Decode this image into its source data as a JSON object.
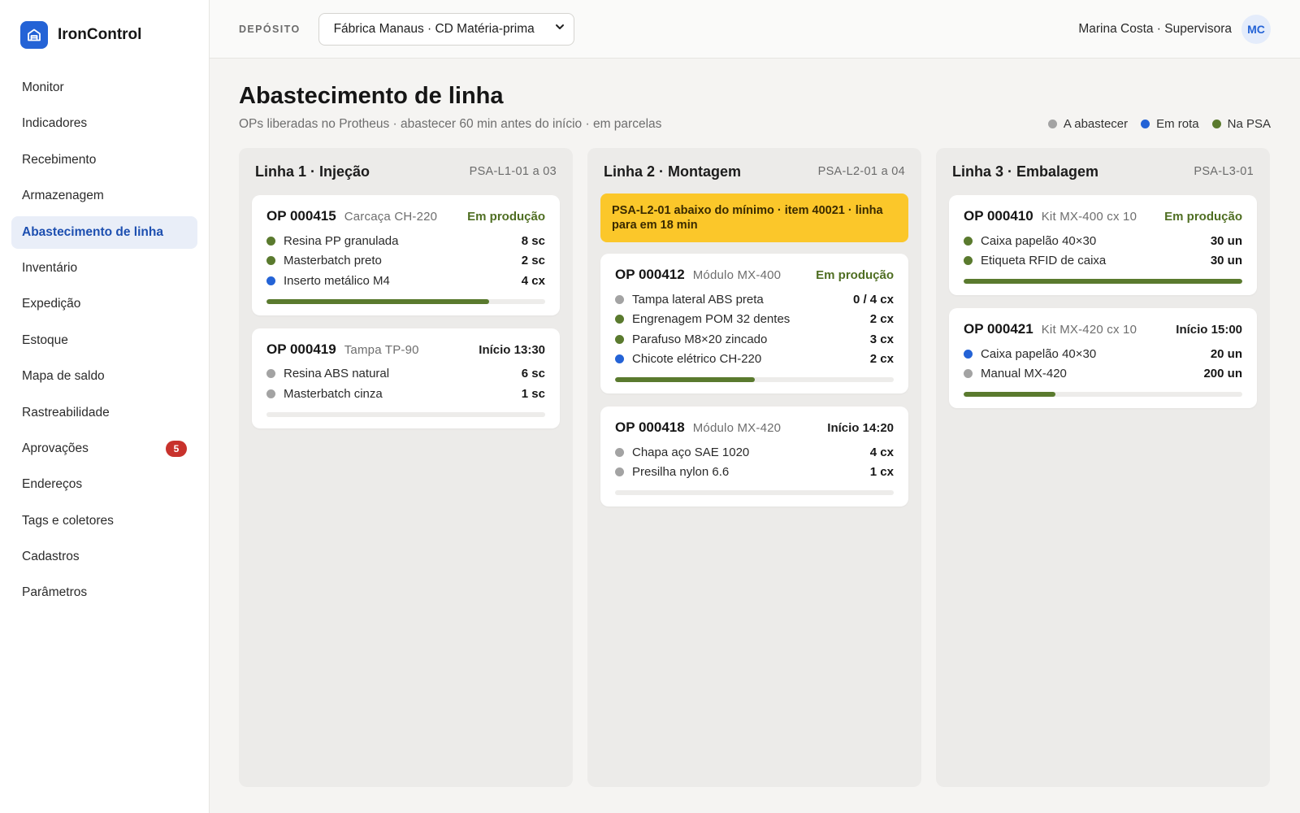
{
  "app": {
    "name": "IronControl"
  },
  "sidebar": {
    "items": [
      {
        "label": "Monitor",
        "name": "sidebar-item-monitor"
      },
      {
        "label": "Indicadores",
        "name": "sidebar-item-indicadores"
      },
      {
        "label": "Recebimento",
        "name": "sidebar-item-recebimento"
      },
      {
        "label": "Armazenagem",
        "name": "sidebar-item-armazenagem"
      },
      {
        "label": "Abastecimento de linha",
        "name": "sidebar-item-abastecimento",
        "active": true
      },
      {
        "label": "Inventário",
        "name": "sidebar-item-inventario"
      },
      {
        "label": "Expedição",
        "name": "sidebar-item-expedicao"
      },
      {
        "label": "Estoque",
        "name": "sidebar-item-estoque"
      },
      {
        "label": "Mapa de saldo",
        "name": "sidebar-item-mapa-de-saldo"
      },
      {
        "label": "Rastreabilidade",
        "name": "sidebar-item-rastreabilidade"
      },
      {
        "label": "Aprovações",
        "name": "sidebar-item-aprovacoes",
        "badge": "5"
      },
      {
        "label": "Endereços",
        "name": "sidebar-item-enderecos"
      },
      {
        "label": "Tags e coletores",
        "name": "sidebar-item-tags-coletores"
      },
      {
        "label": "Cadastros",
        "name": "sidebar-item-cadastros"
      },
      {
        "label": "Parâmetros",
        "name": "sidebar-item-parametros"
      }
    ]
  },
  "header": {
    "deposit_label": "DEPÓSITO",
    "deposit_value": "Fábrica Manaus · CD Matéria-prima",
    "user_name": "Marina Costa · Supervisora",
    "user_initials": "MC"
  },
  "page": {
    "title": "Abastecimento de linha",
    "subtitle": "OPs liberadas no Protheus · abastecer 60 min antes do início · em parcelas"
  },
  "legend": [
    {
      "label": "A abastecer",
      "color": "gray"
    },
    {
      "label": "Em rota",
      "color": "blue"
    },
    {
      "label": "Na PSA",
      "color": "green"
    }
  ],
  "colors": {
    "gray": "#a3a3a3",
    "blue": "#2463d6",
    "green": "#5a7a2e",
    "alert": "#fbc72a",
    "accent": "#2463d6"
  },
  "columns": [
    {
      "title": "Linha 1 · Injeção",
      "psa": "PSA-L1-01 a 03",
      "alert": null,
      "cards": [
        {
          "op": "OP 000415",
          "model": "Carcaça CH-220",
          "status": "Em produção",
          "status_type": "prod",
          "progress": 0.8,
          "items": [
            {
              "label": "Resina PP granulada",
              "qty": "8 sc",
              "state": "green"
            },
            {
              "label": "Masterbatch preto",
              "qty": "2 sc",
              "state": "green"
            },
            {
              "label": "Inserto metálico M4",
              "qty": "4 cx",
              "state": "blue"
            }
          ]
        },
        {
          "op": "OP 000419",
          "model": "Tampa TP-90",
          "status": "Início 13:30",
          "status_type": "start",
          "progress": 0,
          "items": [
            {
              "label": "Resina ABS natural",
              "qty": "6 sc",
              "state": "gray"
            },
            {
              "label": "Masterbatch cinza",
              "qty": "1 sc",
              "state": "gray"
            }
          ]
        }
      ]
    },
    {
      "title": "Linha 2 · Montagem",
      "psa": "PSA-L2-01 a 04",
      "alert": "PSA-L2-01 abaixo do mínimo · item 40021 · linha para em 18 min",
      "cards": [
        {
          "op": "OP 000412",
          "model": "Módulo MX-400",
          "status": "Em produção",
          "status_type": "prod",
          "progress": 0.5,
          "items": [
            {
              "label": "Tampa lateral ABS preta",
              "qty": "0 / 4 cx",
              "state": "gray"
            },
            {
              "label": "Engrenagem POM 32 dentes",
              "qty": "2 cx",
              "state": "green"
            },
            {
              "label": "Parafuso M8×20 zincado",
              "qty": "3 cx",
              "state": "green"
            },
            {
              "label": "Chicote elétrico CH-220",
              "qty": "2 cx",
              "state": "blue"
            }
          ]
        },
        {
          "op": "OP 000418",
          "model": "Módulo MX-420",
          "status": "Início 14:20",
          "status_type": "start",
          "progress": 0,
          "items": [
            {
              "label": "Chapa aço SAE 1020",
              "qty": "4 cx",
              "state": "gray"
            },
            {
              "label": "Presilha nylon 6.6",
              "qty": "1 cx",
              "state": "gray"
            }
          ]
        }
      ]
    },
    {
      "title": "Linha 3 · Embalagem",
      "psa": "PSA-L3-01",
      "alert": null,
      "cards": [
        {
          "op": "OP 000410",
          "model": "Kit MX-400 cx 10",
          "status": "Em produção",
          "status_type": "prod",
          "progress": 1.0,
          "items": [
            {
              "label": "Caixa papelão 40×30",
              "qty": "30 un",
              "state": "green"
            },
            {
              "label": "Etiqueta RFID de caixa",
              "qty": "30 un",
              "state": "green"
            }
          ]
        },
        {
          "op": "OP 000421",
          "model": "Kit MX-420 cx 10",
          "status": "Início 15:00",
          "status_type": "start",
          "progress": 0.33,
          "items": [
            {
              "label": "Caixa papelão 40×30",
              "qty": "20 un",
              "state": "blue"
            },
            {
              "label": "Manual MX-420",
              "qty": "200 un",
              "state": "gray"
            }
          ]
        }
      ]
    }
  ]
}
